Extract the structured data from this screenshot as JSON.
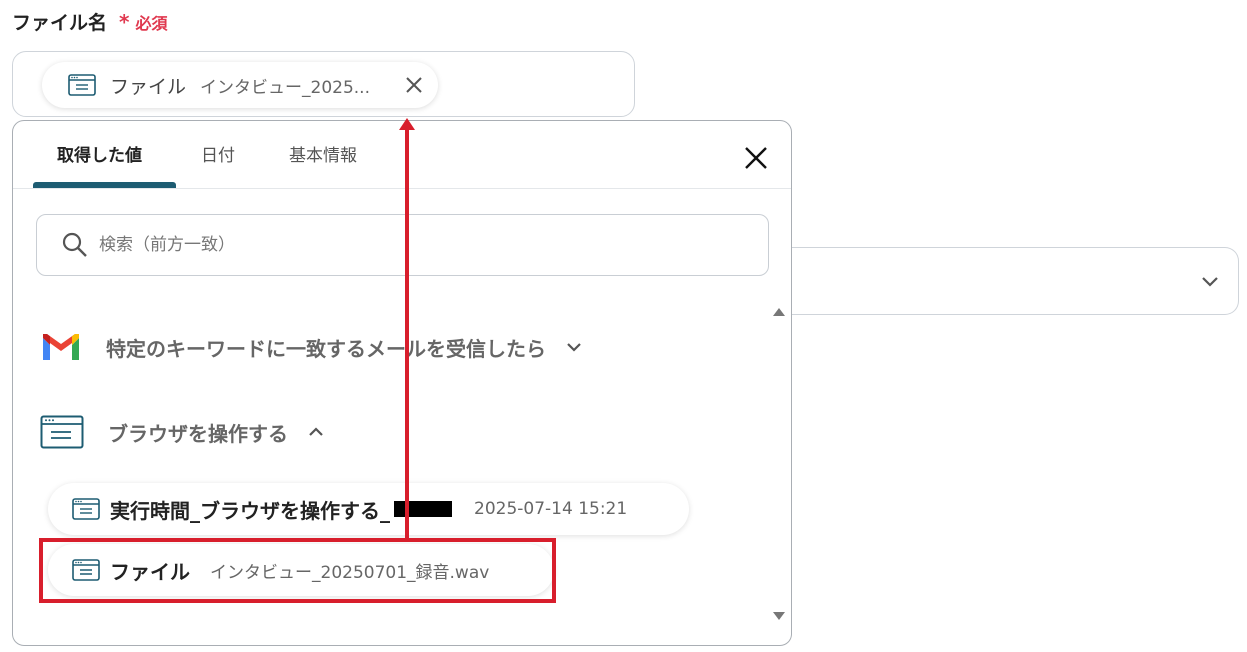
{
  "field": {
    "label": "ファイル名",
    "required_mark": "*",
    "required_text": "必須"
  },
  "selected_chip": {
    "title": "ファイル",
    "value": "インタビュー_2025..."
  },
  "picker": {
    "tabs": [
      {
        "label": "取得した値",
        "active": true
      },
      {
        "label": "日付",
        "active": false
      },
      {
        "label": "基本情報",
        "active": false
      }
    ],
    "search_placeholder": "検索（前方一致）",
    "groups": [
      {
        "label": "特定のキーワードに一致するメールを受信したら",
        "icon": "gmail-icon",
        "expanded": false
      },
      {
        "label": "ブラウザを操作する",
        "icon": "browser-icon",
        "expanded": true
      }
    ],
    "items": [
      {
        "title": "実行時間_ブラウザを操作する_",
        "value": "2025-07-14 15:21",
        "redacted": true
      },
      {
        "title": "ファイル",
        "value": "インタビュー_20250701_録音.wav",
        "highlighted": true
      }
    ]
  },
  "colors": {
    "accent": "#1d5c72",
    "required": "#e0394f",
    "highlight": "#d81e2c"
  }
}
